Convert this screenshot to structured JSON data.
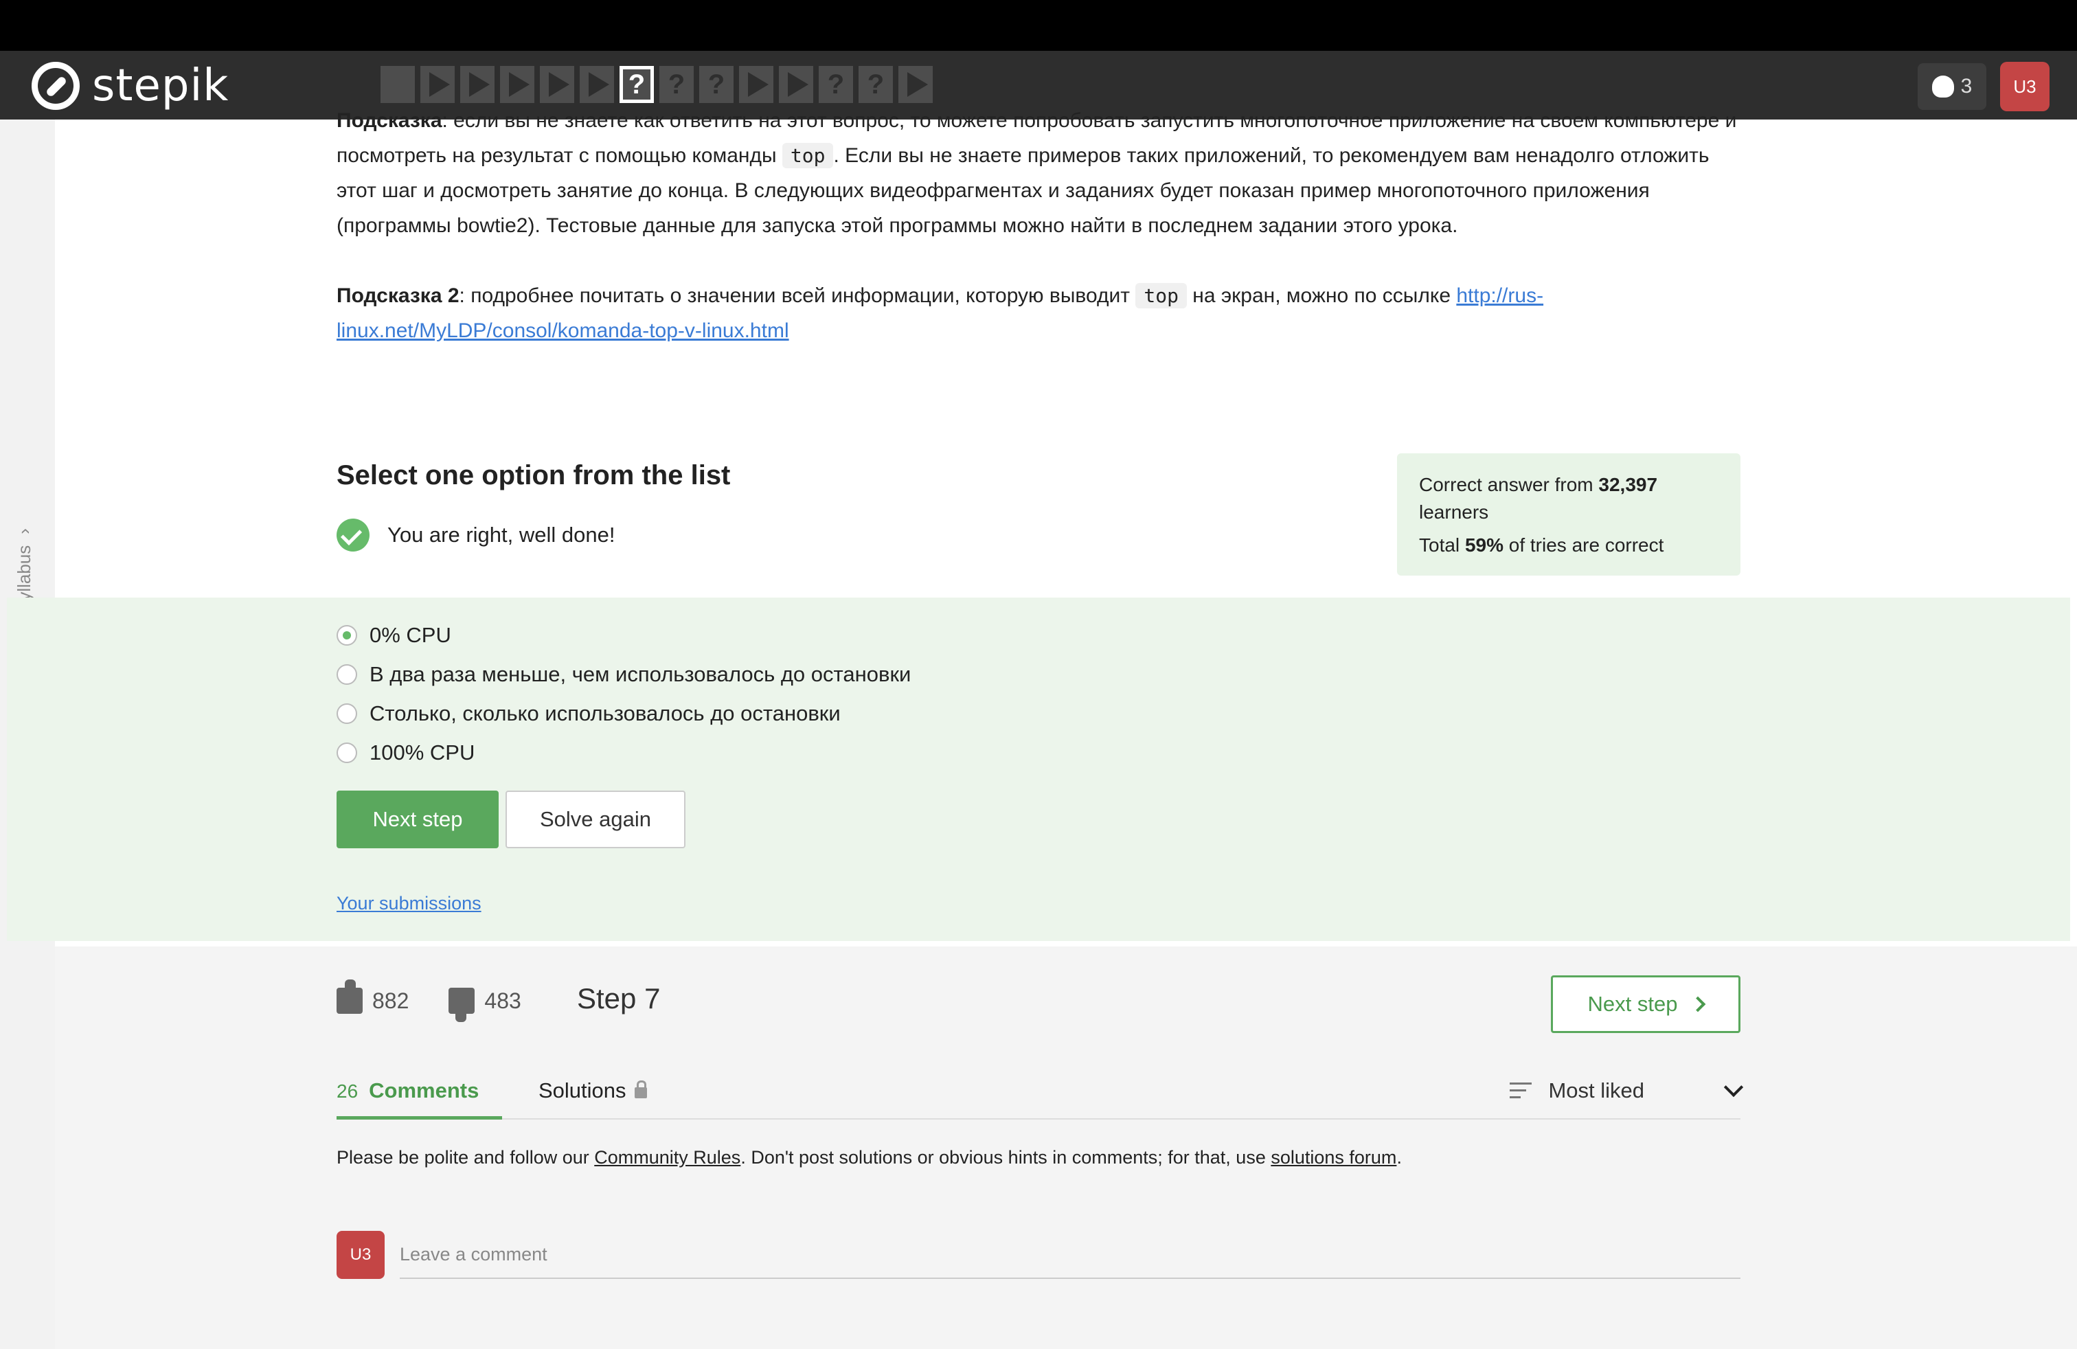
{
  "header": {
    "logo_text": "stepik",
    "steps": [
      {
        "kind": "text"
      },
      {
        "kind": "video"
      },
      {
        "kind": "video"
      },
      {
        "kind": "video"
      },
      {
        "kind": "video"
      },
      {
        "kind": "video"
      },
      {
        "kind": "quiz",
        "current": true
      },
      {
        "kind": "quiz"
      },
      {
        "kind": "quiz"
      },
      {
        "kind": "video"
      },
      {
        "kind": "video"
      },
      {
        "kind": "quiz"
      },
      {
        "kind": "quiz"
      },
      {
        "kind": "video"
      }
    ],
    "quiz_glyph": "?",
    "trophy_count": "3",
    "user_initials": "U3"
  },
  "sidebar": {
    "label": "Syllabus"
  },
  "hint": {
    "hint1_label": "Подсказка",
    "hint1_text_a": ": если вы не знаете как ответить на этот вопрос, то можете попробовать запустить многопоточное приложение на своем компьютере и посмотреть на результат с помощью команды ",
    "code": "top",
    "hint1_text_b": ". Если вы не знаете примеров таких приложений, то рекомендуем вам ненадолго отложить этот шаг и досмотреть занятие до конца. В следующих видеофрагментах и заданиях будет показан пример многопоточного приложения (программы bowtie2). Тестовые данные для запуска этой программы можно найти в последнем задании этого урока.",
    "hint2_label": "Подсказка 2",
    "hint2_text_a": ": подробнее почитать о значении всей информации, которую выводит ",
    "hint2_text_b": " на экран, можно по ссылке ",
    "hint2_link": "http://rus-linux.net/MyLDP/consol/komanda-top-v-linux.html"
  },
  "quiz": {
    "title": "Select one option from the list",
    "feedback": "You are right, well done!",
    "stats_line1_a": "Correct answer from ",
    "stats_learners": "32,397",
    "stats_line1_b": " learners",
    "stats_line2_a": "Total ",
    "stats_percent": "59%",
    "stats_line2_b": " of tries are correct",
    "options": [
      {
        "label": "0% CPU",
        "selected": true
      },
      {
        "label": "В два раза меньше, чем использовалось до остановки",
        "selected": false
      },
      {
        "label": "Столько, сколько использовалось до остановки",
        "selected": false
      },
      {
        "label": "100% CPU",
        "selected": false
      }
    ],
    "next_step_label": "Next step",
    "solve_again_label": "Solve again",
    "submissions_label": "Your submissions"
  },
  "footer": {
    "likes": "882",
    "dislikes": "483",
    "step_label": "Step 7",
    "next_step_label": "Next step",
    "comments_count": "26",
    "comments_label": "Comments",
    "solutions_label": "Solutions",
    "sort_label": "Most liked",
    "rules_a": "Please be polite and follow our ",
    "rules_link1": "Community Rules",
    "rules_b": ". Don't post solutions or obvious hints in comments; for that, use ",
    "rules_link2": "solutions forum",
    "rules_c": ".",
    "comment_placeholder": "Leave a comment",
    "user_initials": "U3"
  },
  "colors": {
    "header_bg": "#2e2e2e",
    "accent_green": "#5aa85d",
    "answer_zone_bg": "#ecf5eb",
    "avatar_red": "#c44545",
    "link_blue": "#3a7bd5"
  }
}
